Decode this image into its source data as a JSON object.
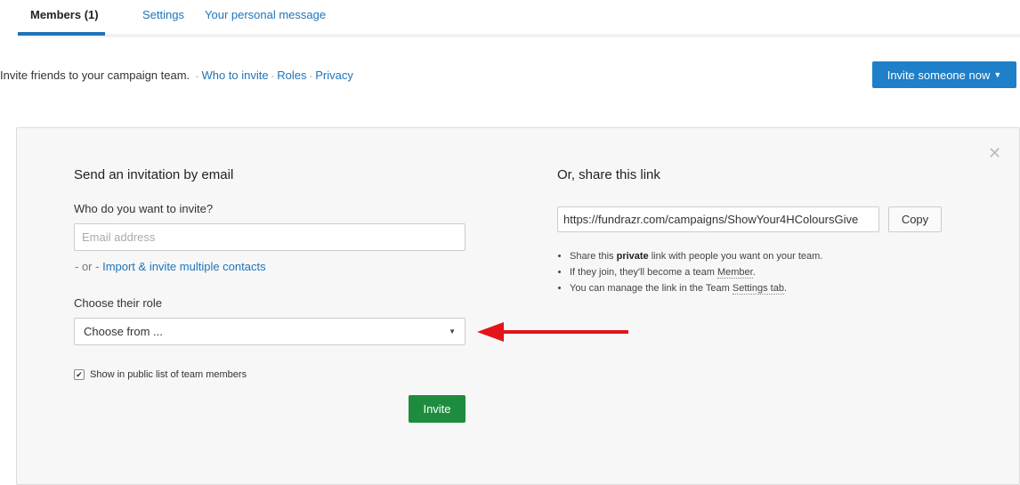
{
  "tabs": [
    {
      "label": "Members (1)",
      "active": true
    },
    {
      "label": "Settings",
      "active": false
    },
    {
      "label": "Your personal message",
      "active": false
    }
  ],
  "intro": {
    "text": "Invite friends to your campaign team.",
    "separator": "-",
    "links": [
      "Who to invite",
      "Roles",
      "Privacy"
    ]
  },
  "invite_now_button": {
    "label": "Invite someone now"
  },
  "email_section": {
    "heading": "Send an invitation by email",
    "who_label": "Who do you want to invite?",
    "email_placeholder": "Email address",
    "or_text": "- or -",
    "import_link": "Import & invite multiple contacts",
    "role_label": "Choose their role",
    "role_selected": "Choose from ...",
    "show_public_label": "Show in public list of team members",
    "show_public_checked": true,
    "invite_button": "Invite"
  },
  "share_section": {
    "heading": "Or, share this link",
    "link_value": "https://fundrazr.com/campaigns/ShowYour4HColoursGive",
    "copy_button": "Copy",
    "bullet1_pre": "Share this",
    "bullet1_bold": "private",
    "bullet1_post": "link with people you want on your team.",
    "bullet2_pre": "If they join, they'll become a team",
    "bullet2_term": "Member",
    "bullet2_post": ".",
    "bullet3_pre": "You can manage the link in the Team",
    "bullet3_link": "Settings tab",
    "bullet3_post": "."
  },
  "colors": {
    "accent": "#1f7fc8",
    "invite_green": "#1e8c3e",
    "annotation_arrow": "#e3141b"
  },
  "icons": {
    "close": "close-icon",
    "dropdown": "caret-down-icon",
    "select_arrow": "select-arrow-icon",
    "checkbox": "checkbox-icon",
    "annotation": "red-arrow-icon"
  }
}
